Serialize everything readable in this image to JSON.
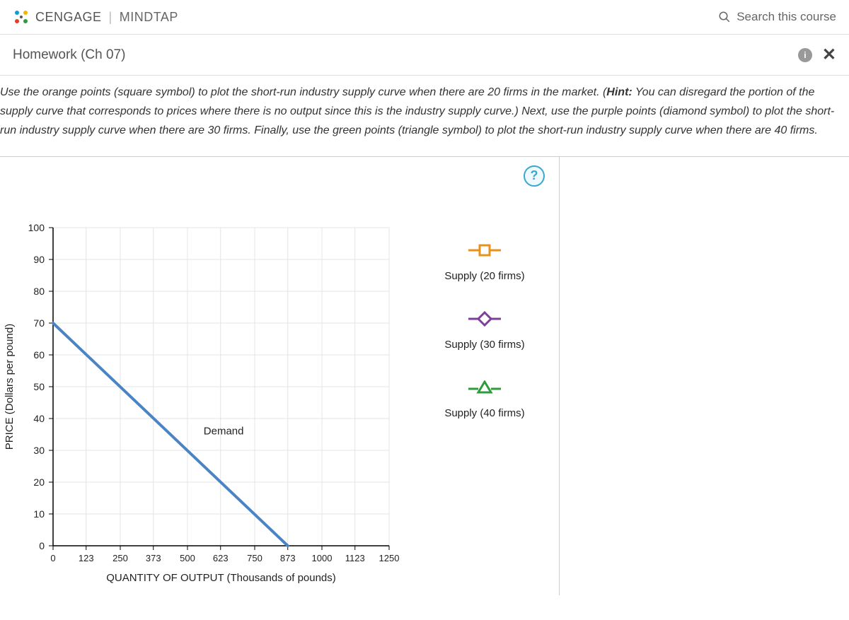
{
  "header": {
    "brand_left": "CENGAGE",
    "brand_right": "MINDTAP",
    "search_placeholder": "Search this course"
  },
  "subheader": {
    "title": "Homework (Ch 07)",
    "info": "i",
    "close": "✕"
  },
  "instructions": {
    "p1a": "Use the orange points (square symbol) to plot the short-run industry supply curve when there are 20 firms in the market. (",
    "hint_label": "Hint:",
    "p1b": " You can disregard the portion of the supply curve that corresponds to prices where there is no output since this is the industry supply curve.) Next, use the purple points (diamond symbol) to plot the short-run industry supply curve when there are 30 firms. Finally, use the green points (triangle symbol) to plot the short-run industry supply curve when there are 40 firms."
  },
  "help": "?",
  "chart_data": {
    "type": "line",
    "title": "",
    "xlabel": "QUANTITY OF OUTPUT (Thousands of pounds)",
    "ylabel": "PRICE (Dollars per pound)",
    "xlim": [
      0,
      1250
    ],
    "ylim": [
      0,
      100
    ],
    "x_ticks": [
      0,
      123,
      250,
      373,
      500,
      623,
      750,
      873,
      1000,
      1123,
      1250
    ],
    "y_ticks": [
      0,
      10,
      20,
      30,
      40,
      50,
      60,
      70,
      80,
      90,
      100
    ],
    "series": [
      {
        "name": "Demand",
        "color": "#4a84c4",
        "points": [
          [
            0,
            70
          ],
          [
            873,
            0
          ]
        ]
      }
    ],
    "annotations": [
      {
        "text": "Demand",
        "x": 560,
        "y": 35
      }
    ],
    "legend_tools": [
      {
        "name": "Supply (20 firms)",
        "symbol": "square",
        "color": "#e8921b"
      },
      {
        "name": "Supply (30 firms)",
        "symbol": "diamond",
        "color": "#7d3f98"
      },
      {
        "name": "Supply (40 firms)",
        "symbol": "triangle",
        "color": "#2e9b3d"
      }
    ]
  },
  "legend": {
    "s20": "Supply (20 firms)",
    "s30": "Supply (30 firms)",
    "s40": "Supply (40 firms)"
  }
}
